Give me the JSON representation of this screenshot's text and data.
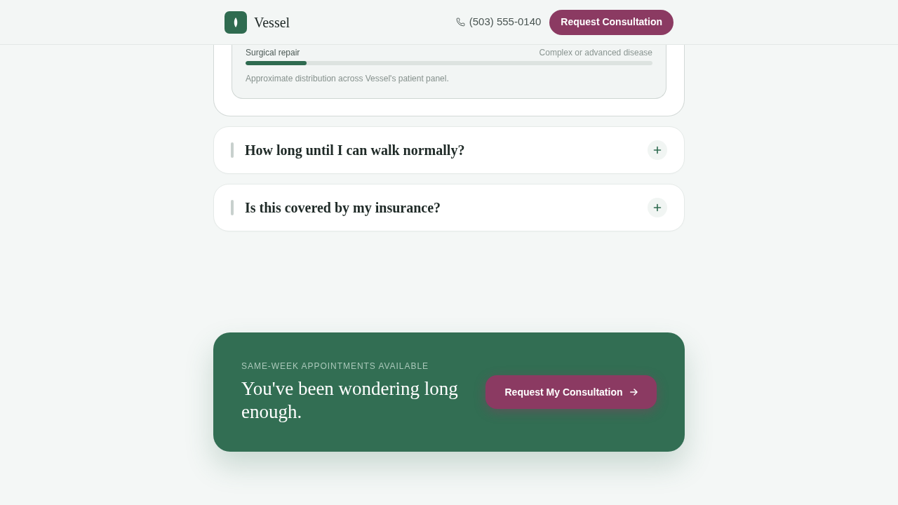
{
  "header": {
    "brand": "Vessel",
    "phone": "(503) 555-0140",
    "cta": "Request Consultation"
  },
  "distribution_card": {
    "rows": [
      {
        "label": "Surgical repair",
        "description": "Complex or advanced disease",
        "level": 0.15
      }
    ],
    "note": "Approximate distribution across Vessel's patient panel."
  },
  "faq": [
    {
      "question": "How long until I can walk normally?",
      "expanded": false
    },
    {
      "question": "Is this covered by my insurance?",
      "expanded": false
    }
  ],
  "cta_banner": {
    "eyebrow": "SAME-WEEK APPOINTMENTS AVAILABLE",
    "heading": "You've been wondering long enough.",
    "button": "Request My Consultation"
  }
}
